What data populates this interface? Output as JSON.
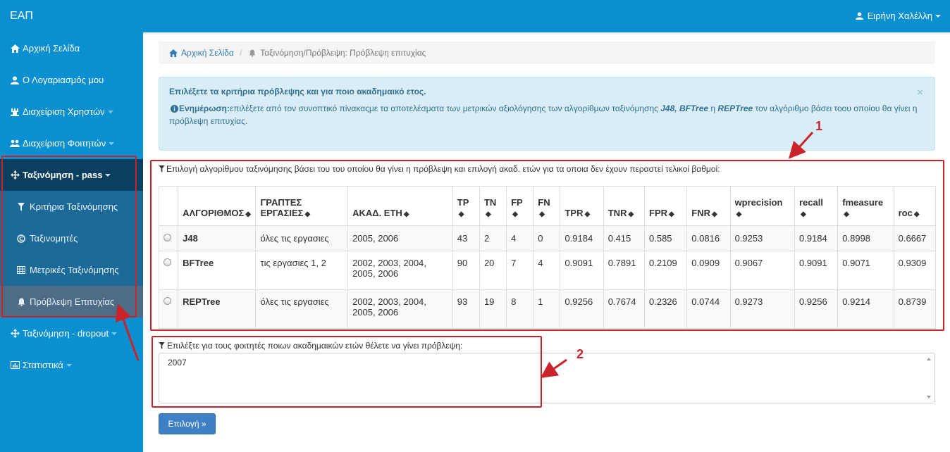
{
  "app": {
    "brand": "ΕΑΠ",
    "user_name": "Ειρήνη Χαλέλλη"
  },
  "sidebar": {
    "items": [
      {
        "label": "Αρχική Σελίδα",
        "icon": "home-icon"
      },
      {
        "label": "Ο Λογαριασμός μου",
        "icon": "user-icon"
      },
      {
        "label": "Διαχείριση Χρηστών",
        "icon": "tower-icon"
      },
      {
        "label": "Διαχείριση Φοιτητών",
        "icon": "users-icon"
      },
      {
        "label": "Ταξινόμηση - pass",
        "icon": "move-icon"
      },
      {
        "label": "Ταξινόμηση - dropout",
        "icon": "move-icon"
      },
      {
        "label": "Στατιστικά",
        "icon": "chart-icon"
      }
    ],
    "subitems": [
      {
        "label": "Κριτήρια Ταξινόμησης",
        "icon": "filter-icon"
      },
      {
        "label": "Ταξινομητές",
        "icon": "copyright-icon"
      },
      {
        "label": "Μετρικές Ταξινόμησης",
        "icon": "table-icon"
      },
      {
        "label": "Πρόβλεψη Επιτυχίας",
        "icon": "bell-icon"
      }
    ]
  },
  "breadcrumb": {
    "home": "Αρχική Σελίδα",
    "current": "Ταξινόμηση/Πρόβλεψη: Πρόβλεψη επιτυχίας"
  },
  "alert": {
    "title": "Επιλέξετε τα κριτήρια πρόβλεψης και για ποιο ακαδημαικό ετος.",
    "info_label": "Ενημέρωση:",
    "msg_a": "επιλέξετε από τον συνοπτικό πίνακαςμε τα αποτελέσματα των μετρικών αξιολόγησης των αλγορίθμων ταξινόμησης ",
    "algo1": "J48, BFTree",
    "msg_b": " η ",
    "algo2": "REPTree",
    "msg_c": " τον αλγόριθμο βάσει τοου οποίου θα γίνει η πρόβλεψη επιτυχίας.",
    "close": "×"
  },
  "table_label": "Επιλογή αλγορίθμου ταξινόμησης βάσει του του οποίου θα γίνει η πρόβλεψη και επιλογή ακαδ. ετών για τα οποια δεν έχουν περαστεί τελικοί βαθμοί:",
  "table": {
    "headers": [
      "ΑΛΓΟΡΙΘΜΟΣ",
      "ΓΡΑΠΤΕΣ ΕΡΓΑΣΙΕΣ",
      "ΑΚΑΔ. ΕΤΗ",
      "TP",
      "TN",
      "FP",
      "FN",
      "TPR",
      "TNR",
      "FPR",
      "FNR",
      "wprecision",
      "recall",
      "fmeasure",
      "roc"
    ],
    "rows": [
      [
        "J48",
        "όλες τις εργασιες",
        "2005, 2006",
        "43",
        "2",
        "4",
        "0",
        "0.9184",
        "0.415",
        "0.585",
        "0.0816",
        "0.9253",
        "0.9184",
        "0.8998",
        "0.6667"
      ],
      [
        "BFTree",
        "τις εργασιες 1, 2",
        "2002, 2003, 2004, 2005, 2006",
        "90",
        "20",
        "7",
        "4",
        "0.9091",
        "0.7891",
        "0.2109",
        "0.0909",
        "0.9067",
        "0.9091",
        "0.9071",
        "0.9309"
      ],
      [
        "REPTree",
        "όλες τις εργασιες",
        "2002, 2003, 2004, 2005, 2006",
        "93",
        "19",
        "8",
        "1",
        "0.9256",
        "0.7674",
        "0.2326",
        "0.0744",
        "0.9273",
        "0.9256",
        "0.9214",
        "0.8739"
      ]
    ]
  },
  "years_label": "Επιλέξτε για τους φοιτητές ποιων ακαδημαικών ετών θέλετε να γίνει πρόβλεψη:",
  "years_value": "2007",
  "submit_label": "Επιλογή »",
  "annotations": {
    "marker1": "1",
    "marker2": "2",
    "color": "#c9242b"
  },
  "colors": {
    "nav": "#0a8fd1",
    "active": "#0b3f5f",
    "link": "#337ab7"
  }
}
